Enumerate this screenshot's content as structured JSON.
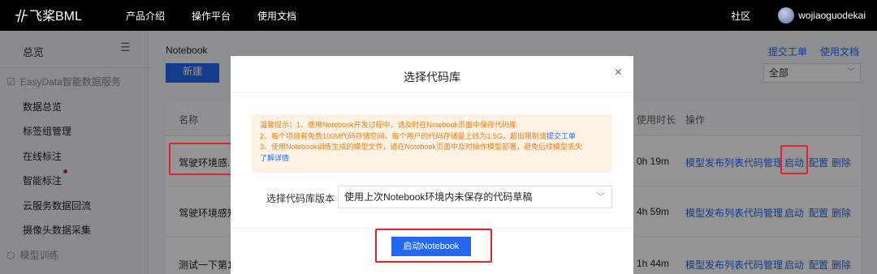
{
  "topbar": {
    "logo_mark": "卝",
    "logo_text": "飞桨BML",
    "nav": [
      "产品介绍",
      "操作平台",
      "使用文档"
    ],
    "community": "社区",
    "username": "wojiaoguodekai"
  },
  "sidebar": {
    "title": "总览",
    "collapse_icon": "☰",
    "group1": "EasyData智能数据服务",
    "items": [
      "数据总览",
      "标签组管理",
      "在线标注",
      "智能标注",
      "云服务数据回流",
      "摄像头数据采集"
    ],
    "group2": "模型训练"
  },
  "main": {
    "page_title": "Notebook",
    "links": [
      "提交工单",
      "使用文档"
    ],
    "new_button": "新建",
    "filter": "全部",
    "table": {
      "headers": [
        "名称",
        "使用时长",
        "操作"
      ],
      "rows": [
        {
          "name": "驾驶环境感...",
          "duration": "0h 19m",
          "actions": [
            "模型发布列表",
            "代码管理",
            "启动",
            "配置",
            "删除"
          ]
        },
        {
          "name": "驾驶环境感知",
          "duration": "4h 59m",
          "actions": [
            "模型发布列表",
            "代码管理",
            "启动",
            "配置",
            "删除"
          ]
        },
        {
          "name": "测试一下第1...",
          "duration": "1h 44m",
          "actions": [
            "模型发布列表",
            "代码管理",
            "启动",
            "配置",
            "删除"
          ]
        }
      ]
    }
  },
  "dialog": {
    "title": "选择代码库",
    "close": "×",
    "tip_lines": [
      "温馨提示：1、使用Notebook开发过程中，请及时在Notebook页面中保存代码库",
      "2、每个项目有免费100M代码存储空间，每个用户的代码存储量上线为1.5G，超出限制请",
      "3、使用Notebook训练生成的模型文件，请在Notebook页面中及时操作模型部署，避免后续模型丢失",
      "了解详情"
    ],
    "tip_link": "提交工单",
    "field_label": "选择代码库版本",
    "select_value": "使用上次Notebook环境内未保存的代码草稿",
    "start_button": "启动Notebook"
  }
}
